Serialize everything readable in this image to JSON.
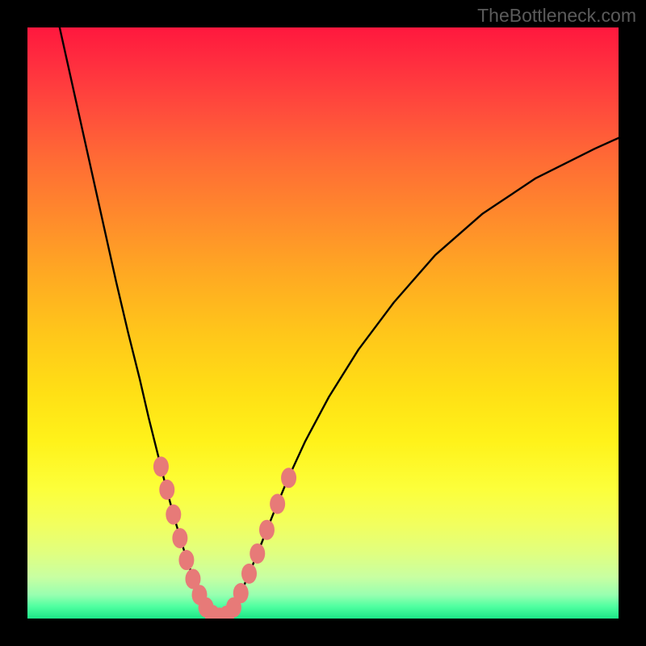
{
  "attribution": "TheBottleneck.com",
  "chart_data": {
    "type": "line",
    "title": "",
    "xlabel": "",
    "ylabel": "",
    "xlim": [
      0,
      100
    ],
    "ylim": [
      0,
      100
    ],
    "curve_points": [
      [
        5,
        102
      ],
      [
        7,
        93
      ],
      [
        9,
        84
      ],
      [
        11,
        75
      ],
      [
        13,
        66
      ],
      [
        15,
        57
      ],
      [
        17,
        48.5
      ],
      [
        19,
        40.5
      ],
      [
        20.5,
        34
      ],
      [
        22,
        28
      ],
      [
        23.5,
        22
      ],
      [
        25,
        16.5
      ],
      [
        26.5,
        11.5
      ],
      [
        27.8,
        7.5
      ],
      [
        29,
        4.3
      ],
      [
        30,
        2.1
      ],
      [
        31,
        0.8
      ],
      [
        32,
        0.2
      ],
      [
        33,
        0.2
      ],
      [
        34,
        0.9
      ],
      [
        35,
        2.3
      ],
      [
        36.3,
        4.8
      ],
      [
        37.8,
        8.3
      ],
      [
        39.5,
        12.5
      ],
      [
        41.5,
        17.5
      ],
      [
        44,
        23.5
      ],
      [
        47,
        30
      ],
      [
        51,
        37.5
      ],
      [
        56,
        45.5
      ],
      [
        62,
        53.5
      ],
      [
        69,
        61.5
      ],
      [
        77,
        68.5
      ],
      [
        86,
        74.5
      ],
      [
        96,
        79.5
      ],
      [
        100,
        81.3
      ]
    ],
    "markers": [
      [
        22.6,
        25.7
      ],
      [
        23.6,
        21.8
      ],
      [
        24.7,
        17.6
      ],
      [
        25.8,
        13.6
      ],
      [
        26.9,
        9.9
      ],
      [
        28.0,
        6.7
      ],
      [
        29.1,
        4.0
      ],
      [
        30.2,
        1.9
      ],
      [
        31.3,
        0.6
      ],
      [
        32.5,
        0.15
      ],
      [
        33.7,
        0.5
      ],
      [
        34.9,
        1.9
      ],
      [
        36.1,
        4.3
      ],
      [
        37.5,
        7.6
      ],
      [
        38.9,
        11.0
      ],
      [
        40.5,
        15.0
      ],
      [
        42.3,
        19.4
      ],
      [
        44.2,
        23.8
      ]
    ],
    "colors": {
      "curve": "#000000",
      "markers": "#e77a78",
      "gradient_top": "#ff183e",
      "gradient_bottom": "#1ce587"
    }
  }
}
